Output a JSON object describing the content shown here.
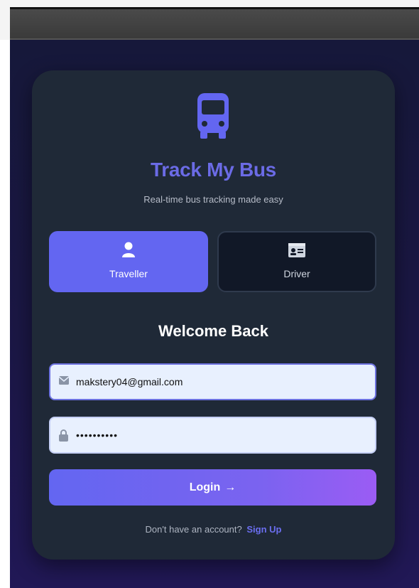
{
  "brand": {
    "title": "Track My Bus",
    "tagline": "Real-time bus tracking made easy",
    "icon": "bus-icon",
    "accent": "#6366f1"
  },
  "roles": [
    {
      "label": "Traveller",
      "icon": "user-icon",
      "selected": true
    },
    {
      "label": "Driver",
      "icon": "id-card-icon",
      "selected": false
    }
  ],
  "form": {
    "heading": "Welcome Back",
    "email": {
      "value": "makstery04@gmail.com",
      "icon": "envelope-icon"
    },
    "password": {
      "value": "••••••••••",
      "icon": "lock-icon"
    },
    "login_label": "Login",
    "login_arrow": "→"
  },
  "signup": {
    "prompt": "Don't have an account?",
    "link": "Sign Up"
  }
}
